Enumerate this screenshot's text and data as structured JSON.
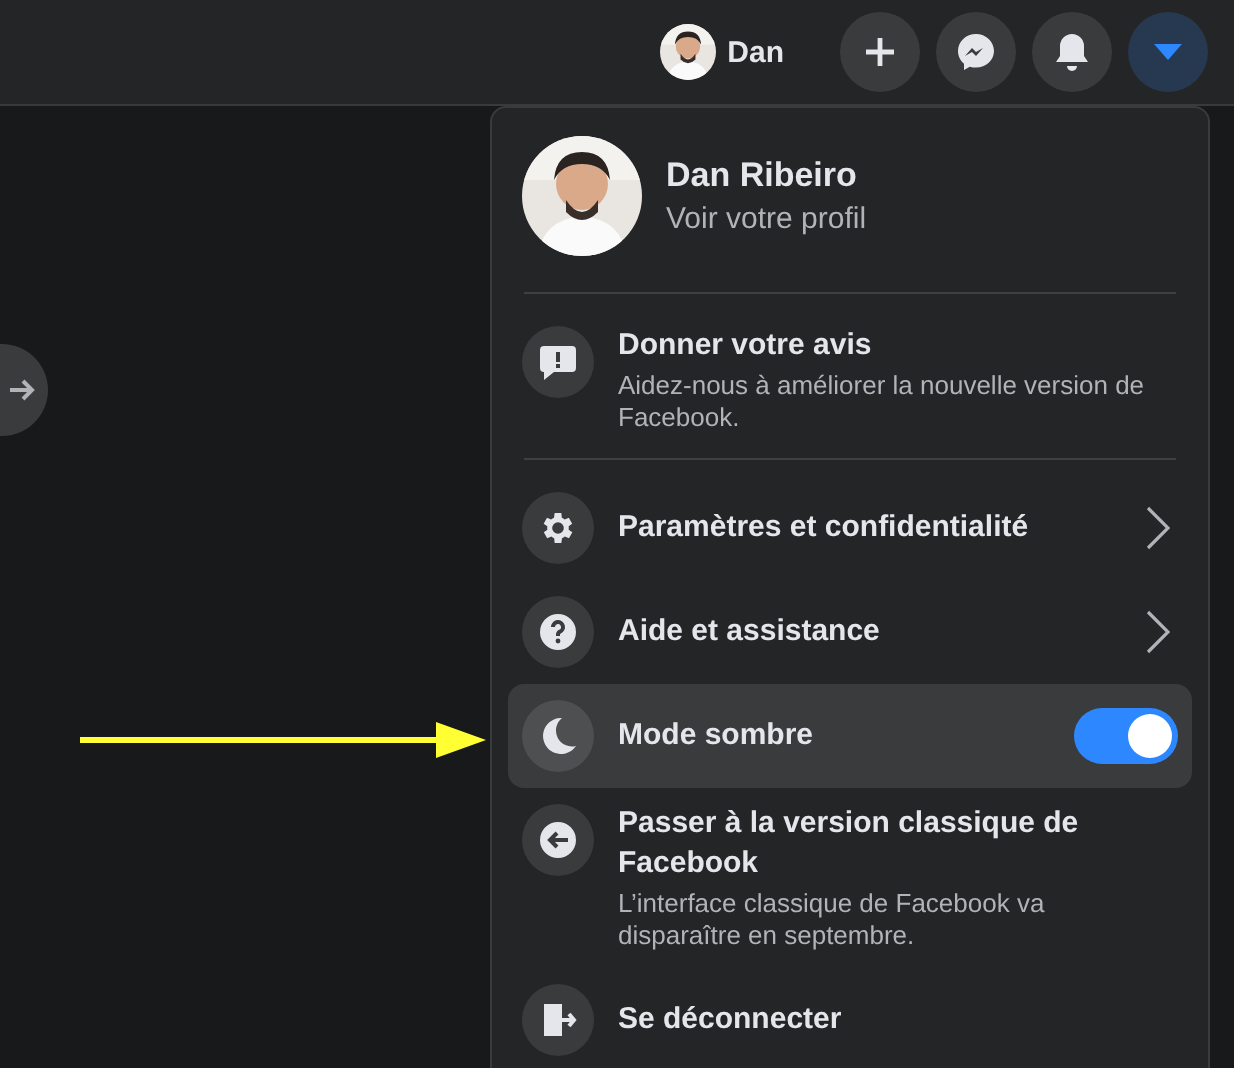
{
  "top_bar": {
    "user": {
      "name": "Dan"
    },
    "buttons": [
      {
        "kind": "create"
      },
      {
        "kind": "messenger"
      },
      {
        "kind": "notifications"
      },
      {
        "kind": "account",
        "selected": true
      }
    ]
  },
  "account_menu": {
    "profile": {
      "name": "Dan Ribeiro",
      "subtitle": "Voir votre profil"
    },
    "sections": [
      {
        "items": [
          {
            "kind": "plain",
            "title": "Donner votre avis",
            "description": "Aidez-nous à améliorer la nouvelle version de Facebook."
          }
        ]
      },
      {
        "items": [
          {
            "kind": "submenu",
            "title": "Paramètres et confidentialité"
          },
          {
            "kind": "submenu",
            "title": "Aide et assistance"
          },
          {
            "kind": "toggle",
            "title": "Mode sombre",
            "on": true,
            "selected": true
          },
          {
            "kind": "plain",
            "title": "Passer à la version classique de Facebook",
            "description": "L’interface classique de Facebook va disparaître en septembre."
          },
          {
            "kind": "plain",
            "title": "Se déconnecter"
          }
        ]
      }
    ]
  }
}
